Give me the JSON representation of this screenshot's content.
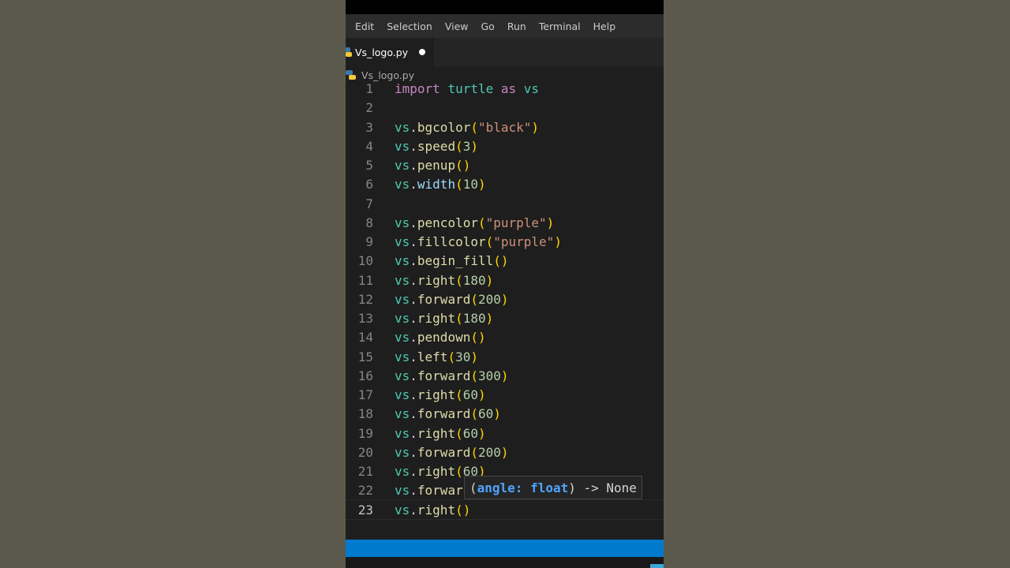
{
  "menu": [
    "Edit",
    "Selection",
    "View",
    "Go",
    "Run",
    "Terminal",
    "Help"
  ],
  "tab": {
    "filename": "Vs_logo.py",
    "icon": "python-icon",
    "modified": true
  },
  "breadcrumb": {
    "filename": "Vs_logo.py",
    "icon": "python-icon"
  },
  "editor": {
    "active_line": 23,
    "lines": [
      {
        "n": "1",
        "text": "import turtle as vs"
      },
      {
        "n": "2",
        "text": ""
      },
      {
        "n": "3",
        "text": "vs.bgcolor(\"black\")"
      },
      {
        "n": "4",
        "text": "vs.speed(3)"
      },
      {
        "n": "5",
        "text": "vs.penup()"
      },
      {
        "n": "6",
        "text": "vs.width(10)"
      },
      {
        "n": "7",
        "text": ""
      },
      {
        "n": "8",
        "text": "vs.pencolor(\"purple\")"
      },
      {
        "n": "9",
        "text": "vs.fillcolor(\"purple\")"
      },
      {
        "n": "10",
        "text": "vs.begin_fill()"
      },
      {
        "n": "11",
        "text": "vs.right(180)"
      },
      {
        "n": "12",
        "text": "vs.forward(200)"
      },
      {
        "n": "13",
        "text": "vs.right(180)"
      },
      {
        "n": "14",
        "text": "vs.pendown()"
      },
      {
        "n": "15",
        "text": "vs.left(30)"
      },
      {
        "n": "16",
        "text": "vs.forward(300)"
      },
      {
        "n": "17",
        "text": "vs.right(60)"
      },
      {
        "n": "18",
        "text": "vs.forward(60)"
      },
      {
        "n": "19",
        "text": "vs.right(60)"
      },
      {
        "n": "20",
        "text": "vs.forward(200)"
      },
      {
        "n": "21",
        "text": "vs.right(60)"
      },
      {
        "n": "22",
        "text": "vs.forwar"
      },
      {
        "n": "23",
        "text": "vs.right()"
      }
    ]
  },
  "tooltip": {
    "open": "(",
    "param": "angle: float",
    "rest": ") -> None"
  },
  "colors": {
    "keyword": "#c586c0",
    "module": "#4ec9b0",
    "method": "#dcdcaa",
    "string": "#ce9178",
    "number": "#b5cea8",
    "bracket": "#ffd700",
    "statusbar": "#007acc",
    "tooltip_param": "#4fa4ff"
  }
}
